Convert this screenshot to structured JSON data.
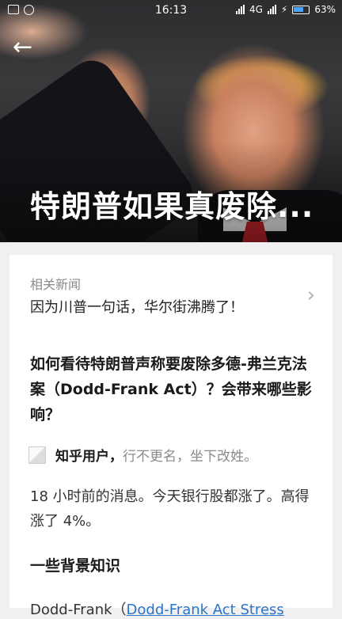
{
  "status_bar": {
    "time": "16:13",
    "network": "4G",
    "battery": "63%"
  },
  "hero": {
    "title": "特朗普如果真废除..."
  },
  "related": {
    "label": "相关新闻",
    "title": "因为川普一句话，华尔街沸腾了！"
  },
  "question": {
    "title": "如何看待特朗普声称要废除多德-弗兰克法案（Dodd-Frank Act）？会带来哪些影响？"
  },
  "author": {
    "name": "知乎用户，",
    "bio": "行不更名，坐下改姓。"
  },
  "answer": {
    "text": "18 小时前的消息。今天银行股都涨了。高得涨了 4%。",
    "section_heading": "一些背景知识",
    "partial_prefix": "Dodd-Frank（",
    "partial_link": "Dodd-Frank Act Stress"
  },
  "colors": {
    "link": "#2b74c7",
    "battery_accent": "#4aa3ff"
  }
}
